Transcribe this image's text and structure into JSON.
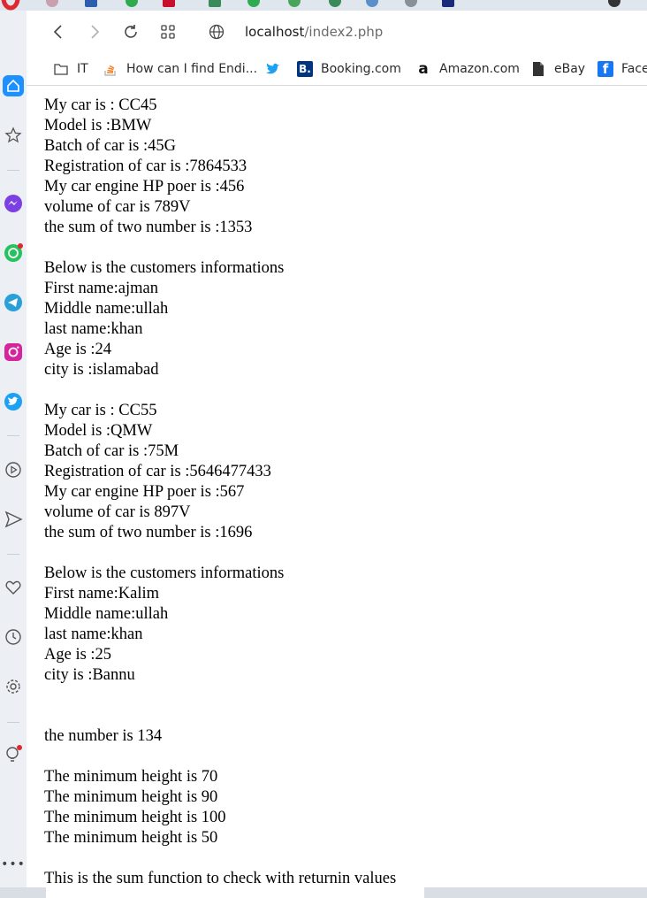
{
  "browser": {
    "url": {
      "host": "localhost",
      "path": "/index2.php"
    },
    "bookmarks": [
      {
        "label": "IT",
        "icon": "folder-icon"
      },
      {
        "label": "How can I find Endi...",
        "icon": "stackoverflow-icon"
      },
      {
        "label": "",
        "icon": "twitter-icon"
      },
      {
        "label": "Booking.com",
        "icon": "booking-icon"
      },
      {
        "label": "Amazon.com",
        "icon": "amazon-icon"
      },
      {
        "label": "eBay",
        "icon": "document-icon"
      },
      {
        "label": "Face",
        "icon": "facebook-icon"
      }
    ]
  },
  "page": {
    "car1": [
      "My car is : CC45",
      "Model is :BMW",
      "Batch of car is :45G",
      "Registration of car is :7864533",
      "My car engine HP poer is :456",
      "volume of car is 789V",
      "the sum of two number is :1353"
    ],
    "customer1": [
      "Below is the customers informations",
      "First name:ajman",
      "Middle name:ullah",
      "last name:khan",
      "Age is :24",
      "city is :islamabad"
    ],
    "car2": [
      "My car is : CC55",
      "Model is :QMW",
      "Batch of car is :75M",
      "Registration of car is :5646477433",
      "My car engine HP poer is :567",
      "volume of car is 897V",
      "the sum of two number is :1696"
    ],
    "customer2": [
      "Below is the customers informations",
      "First name:Kalim",
      "Middle name:ullah",
      "last name:khan",
      "Age is :25",
      "city is :Bannu"
    ],
    "number_line": "the number is 134",
    "heights": [
      "The minimum height is 70",
      "The minimum height is 90",
      "The minimum height is 100",
      "The minimum height is 50"
    ],
    "sum_line": "This is the sum function to check with returnin values"
  }
}
